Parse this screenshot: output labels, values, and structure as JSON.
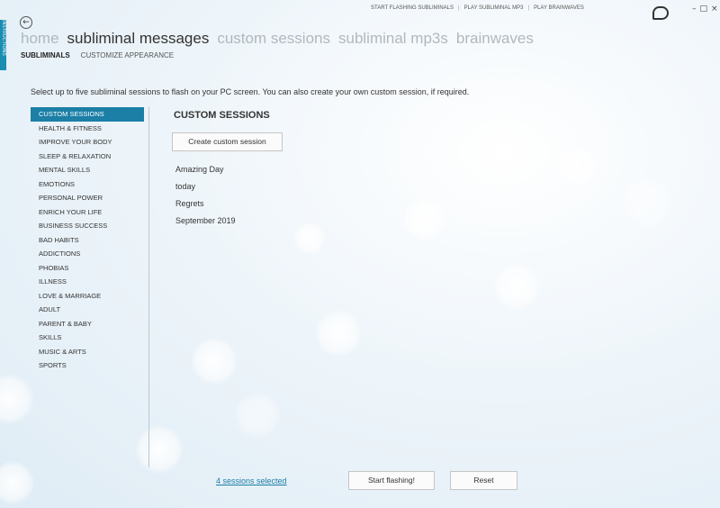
{
  "sidebar_tab": {
    "label": "INSTRUCTIONS"
  },
  "top_links": [
    {
      "label": "START FLASHING SUBLIMINALS"
    },
    {
      "label": "PLAY SUBLIMINAL MP3"
    },
    {
      "label": "PLAY BRAINWAVES"
    }
  ],
  "window_controls": {
    "minimize": "–",
    "maximize": "□",
    "close": "×"
  },
  "nav": {
    "tabs": [
      {
        "label": "home"
      },
      {
        "label": "subliminal messages"
      },
      {
        "label": "custom sessions"
      },
      {
        "label": "subliminal mp3s"
      },
      {
        "label": "brainwaves"
      }
    ],
    "active": "subliminal messages"
  },
  "subnav": {
    "items": [
      {
        "label": "SUBLIMINALS"
      },
      {
        "label": "CUSTOMIZE APPEARANCE"
      }
    ]
  },
  "intro": "Select up to five subliminal sessions to flash on your PC screen. You can also create your own custom session, if required.",
  "categories": [
    {
      "label": "CUSTOM SESSIONS"
    },
    {
      "label": "HEALTH & FITNESS"
    },
    {
      "label": "IMPROVE YOUR BODY"
    },
    {
      "label": "SLEEP & RELAXATION"
    },
    {
      "label": "MENTAL SKILLS"
    },
    {
      "label": "EMOTIONS"
    },
    {
      "label": "PERSONAL POWER"
    },
    {
      "label": "ENRICH YOUR LIFE"
    },
    {
      "label": "BUSINESS SUCCESS"
    },
    {
      "label": "BAD HABITS"
    },
    {
      "label": "ADDICTIONS"
    },
    {
      "label": "PHOBIAS"
    },
    {
      "label": "ILLNESS"
    },
    {
      "label": "LOVE & MARRIAGE"
    },
    {
      "label": "ADULT"
    },
    {
      "label": "PARENT & BABY"
    },
    {
      "label": "SKILLS"
    },
    {
      "label": "MUSIC & ARTS"
    },
    {
      "label": "SPORTS"
    }
  ],
  "main": {
    "title": "CUSTOM SESSIONS",
    "create_button": "Create custom session",
    "sessions": [
      {
        "label": "Amazing Day"
      },
      {
        "label": "today"
      },
      {
        "label": "Regrets"
      },
      {
        "label": "September 2019"
      }
    ]
  },
  "footer": {
    "selected_link": "4 sessions selected",
    "start_button": "Start flashing!",
    "reset_button": "Reset"
  },
  "colors": {
    "accent": "#1b7fa6"
  }
}
